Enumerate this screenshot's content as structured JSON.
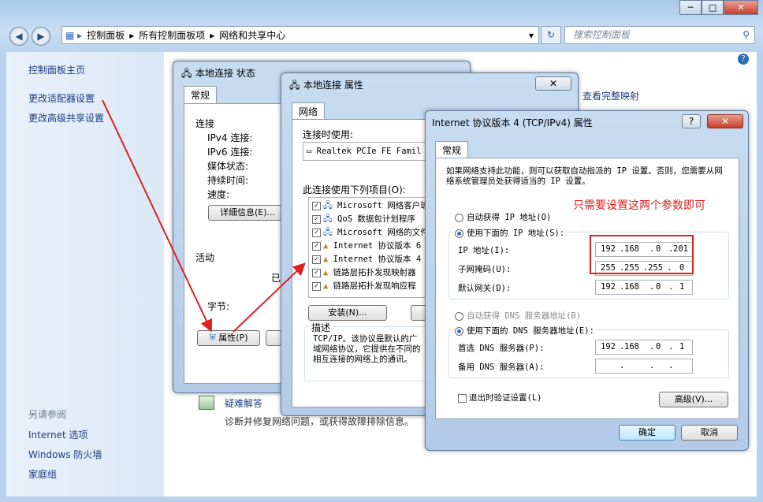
{
  "window": {
    "breadcrumb": [
      "控制面板",
      "所有控制面板项",
      "网络和共享中心"
    ],
    "search_placeholder": "搜索控制面板",
    "buttons": {
      "minimize": "─",
      "maximize": "□",
      "close": "✕"
    }
  },
  "sidebar": {
    "links": [
      "控制面板主页",
      "更改适配器设置",
      "更改高级共享设置"
    ],
    "see_also_title": "另请参阅",
    "see_also": [
      "Internet 选项",
      "Windows 防火墙",
      "家庭组"
    ]
  },
  "main": {
    "view_full_map": "查看完整映射",
    "troubleshoot_link": "疑难解答",
    "troubleshoot_desc": "诊断并修复网络问题，或获得故障排除信息。"
  },
  "status_dialog": {
    "title": "本地连接 状态",
    "tab": "常规",
    "connection_label": "连接",
    "fields": [
      "IPv4 连接:",
      "IPv6 连接:",
      "媒体状态:",
      "持续时间:",
      "速度:"
    ],
    "details_button": "详细信息(E)...",
    "activity_label": "活动",
    "sent_prefix": "已",
    "bytes_label": "字节:",
    "properties_button": "属性(P)"
  },
  "props_dialog": {
    "title": "本地连接 属性",
    "tab": "网络",
    "connect_using": "连接时使用:",
    "adapter": "Realtek PCIe FE Famil",
    "items_label": "此连接使用下列项目(O):",
    "items": [
      "Microsoft 网络客户端",
      "QoS 数据包计划程序",
      "Microsoft 网络的文件",
      "Internet 协议版本 6",
      "Internet 协议版本 4",
      "链路层拓扑发现映射器",
      "链路层拓扑发现响应程"
    ],
    "install_button": "安装(N)...",
    "uninstall_button": "卸载",
    "description_label": "描述",
    "description": "TCP/IP。该协议是默认的广域网络协议，它提供在不同的相互连接的网络上的通讯。"
  },
  "ipv4_dialog": {
    "title": "Internet 协议版本 4 (TCP/IPv4) 属性",
    "tab": "常规",
    "intro": "如果网络支持此功能，则可以获取自动指派的 IP 设置。否则，您需要从网络系统管理员处获得适当的 IP 设置。",
    "auto_ip": "自动获得 IP 地址(O)",
    "use_ip": "使用下面的 IP 地址(S):",
    "ip_label": "IP 地址(I):",
    "ip_value": [
      "192",
      "168",
      "0",
      "201"
    ],
    "mask_label": "子网掩码(U):",
    "mask_value": [
      "255",
      "255",
      "255",
      "0"
    ],
    "gateway_label": "默认网关(D):",
    "gateway_value": [
      "192",
      "168",
      "0",
      "1"
    ],
    "auto_dns": "自动获得 DNS 服务器地址(B)",
    "use_dns": "使用下面的 DNS 服务器地址(E):",
    "dns1_label": "首选 DNS 服务器(P):",
    "dns1_value": [
      "192",
      "168",
      "0",
      "1"
    ],
    "dns2_label": "备用 DNS 服务器(A):",
    "validate": "退出时验证设置(L)",
    "advanced_button": "高级(V)...",
    "ok_button": "确定",
    "cancel_button": "取消",
    "help": "?",
    "close": "✕"
  },
  "annotation": {
    "text": "只需要设置这两个参数即可",
    "color": "#e02020"
  }
}
